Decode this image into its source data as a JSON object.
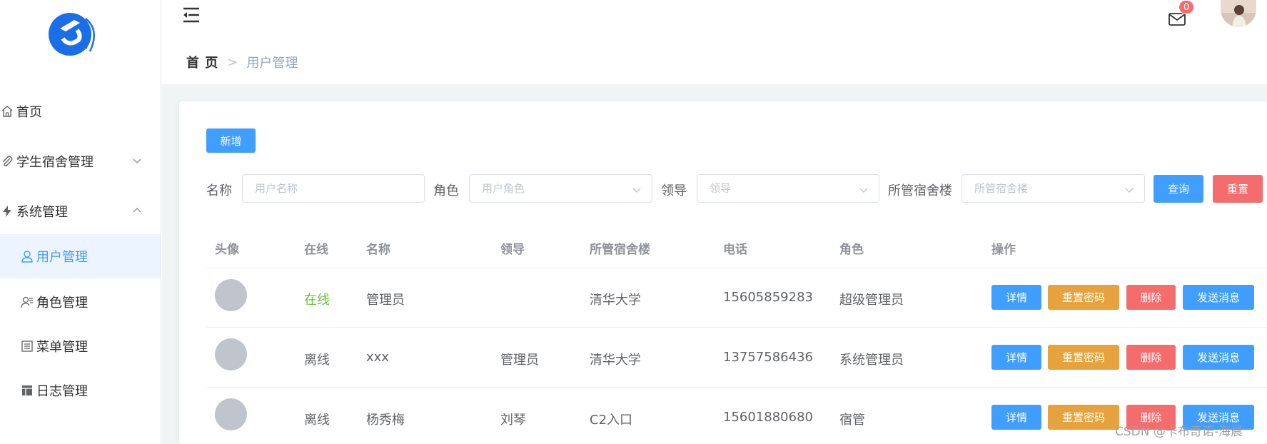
{
  "colors": {
    "primary": "#409eff",
    "warning": "#e6a23c",
    "danger": "#f56c6c",
    "success": "#67c23a",
    "active_bg": "#ecf5ff"
  },
  "sidebar": {
    "logo_icon": "logo-icon",
    "items": [
      {
        "label": "首页",
        "icon": "home-icon"
      },
      {
        "label": "学生宿舍管理",
        "icon": "paperclip-icon",
        "state": "collapsed"
      },
      {
        "label": "系统管理",
        "icon": "lightning-icon",
        "state": "expanded"
      }
    ],
    "sub_items": [
      {
        "label": "用户管理",
        "icon": "user-icon",
        "active": true
      },
      {
        "label": "角色管理",
        "icon": "user-list-icon"
      },
      {
        "label": "菜单管理",
        "icon": "list-icon"
      },
      {
        "label": "日志管理",
        "icon": "table-icon"
      }
    ]
  },
  "header": {
    "breadcrumb": {
      "home": "首 页",
      "separator": ">",
      "current": "用户管理"
    },
    "notification_count": "0"
  },
  "toolbar": {
    "add_label": "新增",
    "filters": {
      "name_label": "名称",
      "name_placeholder": "用户名称",
      "role_label": "角色",
      "role_placeholder": "用户角色",
      "leader_label": "领导",
      "leader_placeholder": "领导",
      "building_label": "所管宿舍楼",
      "building_placeholder": "所管宿舍楼"
    },
    "search_label": "查询",
    "reset_label": "重置"
  },
  "table": {
    "headers": [
      "头像",
      "在线",
      "名称",
      "领导",
      "所管宿舍楼",
      "电话",
      "角色",
      "操作"
    ],
    "rows": [
      {
        "online": "在线",
        "name": "管理员",
        "leader": "",
        "building": "清华大学",
        "phone": "15605859283",
        "role": "超级管理员"
      },
      {
        "online": "离线",
        "name": "xxx",
        "leader": "管理员",
        "building": "清华大学",
        "phone": "13757586436",
        "role": "系统管理员"
      },
      {
        "online": "离线",
        "name": "杨秀梅",
        "leader": "刘琴",
        "building": "C2入口",
        "phone": "15601880680",
        "role": "宿管"
      }
    ],
    "actions": {
      "detail": "详情",
      "reset_pwd": "重置密码",
      "delete": "删除",
      "send_msg": "发送消息"
    }
  },
  "watermark": "CSDN @卡布奇诺-海晨"
}
